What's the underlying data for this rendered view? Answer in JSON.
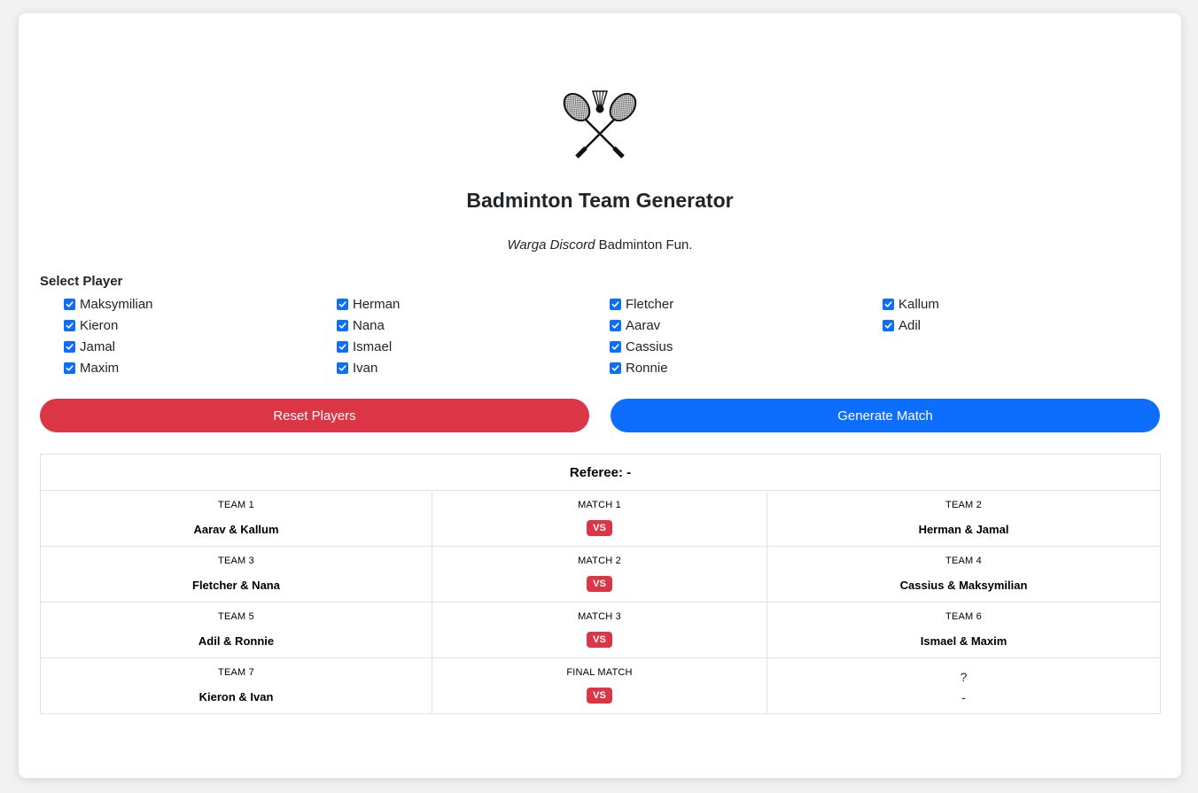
{
  "app": {
    "title": "Badminton Team Generator",
    "subtitle_italic": "Warga Discord",
    "subtitle_rest": " Badminton Fun."
  },
  "select_player_label": "Select Player",
  "players": [
    {
      "name": "Maksymilian",
      "checked": true
    },
    {
      "name": "Kieron",
      "checked": true
    },
    {
      "name": "Jamal",
      "checked": true
    },
    {
      "name": "Maxim",
      "checked": true
    },
    {
      "name": "Herman",
      "checked": true
    },
    {
      "name": "Nana",
      "checked": true
    },
    {
      "name": "Ismael",
      "checked": true
    },
    {
      "name": "Ivan",
      "checked": true
    },
    {
      "name": "Fletcher",
      "checked": true
    },
    {
      "name": "Aarav",
      "checked": true
    },
    {
      "name": "Cassius",
      "checked": true
    },
    {
      "name": "Ronnie",
      "checked": true
    },
    {
      "name": "Kallum",
      "checked": true
    },
    {
      "name": "Adil",
      "checked": true
    }
  ],
  "buttons": {
    "reset_label": "Reset Players",
    "generate_label": "Generate Match"
  },
  "results": {
    "referee": "Referee: -",
    "vs_label": "VS",
    "rows": [
      {
        "left_label": "TEAM 1",
        "left_team": "Aarav & Kallum",
        "match_label": "MATCH 1",
        "right_label": "TEAM 2",
        "right_team": "Herman & Jamal"
      },
      {
        "left_label": "TEAM 3",
        "left_team": "Fletcher & Nana",
        "match_label": "MATCH 2",
        "right_label": "TEAM 4",
        "right_team": "Cassius & Maksymilian"
      },
      {
        "left_label": "TEAM 5",
        "left_team": "Adil & Ronnie",
        "match_label": "MATCH 3",
        "right_label": "TEAM 6",
        "right_team": "Ismael & Maxim"
      }
    ],
    "final": {
      "left_label": "TEAM 7",
      "left_team": "Kieron & Ivan",
      "match_label": "FINAL MATCH",
      "right_label": "?",
      "right_team": "-"
    }
  },
  "colors": {
    "reset": "#dc3545",
    "generate": "#0d6efd",
    "checkbox": "#0d6efd"
  }
}
